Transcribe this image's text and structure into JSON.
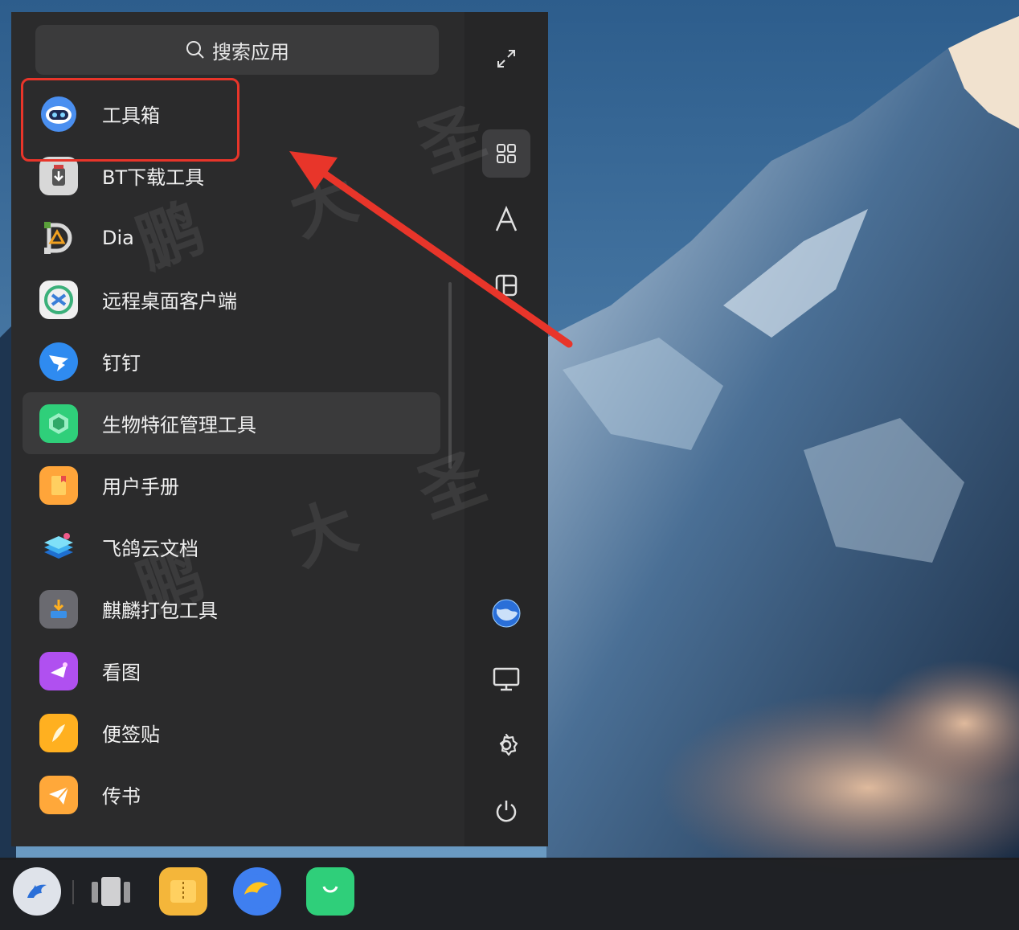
{
  "search": {
    "placeholder": "搜索应用",
    "icon": "search-icon"
  },
  "apps": [
    {
      "label": "工具箱",
      "icon": "toolbox-robot-icon"
    },
    {
      "label": "BT下载工具",
      "icon": "bt-download-icon"
    },
    {
      "label": "Dia",
      "icon": "dia-icon"
    },
    {
      "label": "远程桌面客户端",
      "icon": "remote-desktop-icon"
    },
    {
      "label": "钉钉",
      "icon": "dingtalk-icon"
    },
    {
      "label": "生物特征管理工具",
      "icon": "biometric-icon"
    },
    {
      "label": "用户手册",
      "icon": "user-manual-icon"
    },
    {
      "label": "飞鸽云文档",
      "icon": "feige-cloud-docs-icon"
    },
    {
      "label": "麒麟打包工具",
      "icon": "kylin-packager-icon"
    },
    {
      "label": "看图",
      "icon": "image-viewer-icon"
    },
    {
      "label": "便签贴",
      "icon": "sticky-notes-icon"
    },
    {
      "label": "传书",
      "icon": "chuanshu-icon"
    }
  ],
  "highlighted_app_index": 5,
  "side_icons": [
    "expand-icon",
    "grid-view-icon",
    "alphabet-sort-icon",
    "category-view-icon",
    "globe-avatar-icon",
    "monitor-icon",
    "settings-icon",
    "power-icon"
  ],
  "taskbar": [
    "kylin-start-icon",
    "multitask-view-icon",
    "file-manager-icon",
    "browser-icon",
    "software-store-icon"
  ],
  "colors": {
    "annotation_red": "#e8352a",
    "menu_bg": "#2b2b2c",
    "highlight": "#3a3a3b"
  }
}
